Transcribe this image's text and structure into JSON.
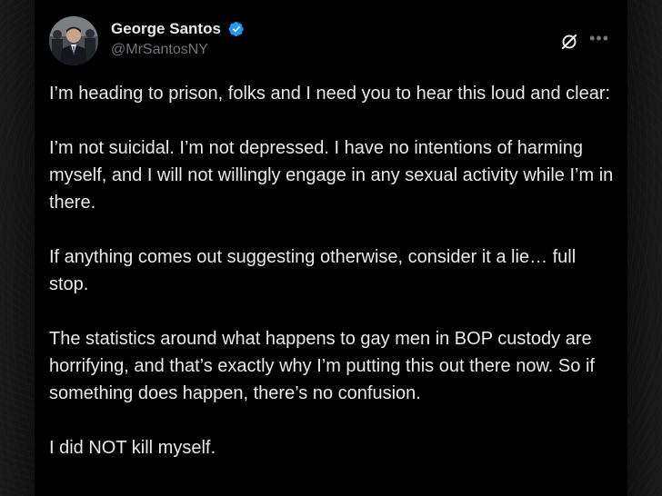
{
  "author": {
    "display_name": "George Santos",
    "handle": "@MrSantosNY",
    "verified": true,
    "verified_color": "#1d9bf0"
  },
  "icons": {
    "verified": "verified-badge-icon",
    "grok": "grok-icon",
    "more": "more-options-icon"
  },
  "tweet": {
    "paragraphs": [
      "I’m heading to prison, folks and I need you to hear this loud and clear:",
      "I’m not suicidal. I’m not depressed. I have no intentions of harming myself, and I will not willingly engage in any sexual activity while I’m in there.",
      "If anything comes out suggesting otherwise, consider it a lie… full stop.",
      "The statistics around what happens to gay men in BOP custody are horrifying, and that’s exactly why I’m putting this out there now. So if something does happen, there’s no confusion.",
      "I did NOT kill myself."
    ]
  },
  "colors": {
    "text_primary": "#e7e9ea",
    "text_secondary": "#71767b",
    "background": "#000000"
  }
}
